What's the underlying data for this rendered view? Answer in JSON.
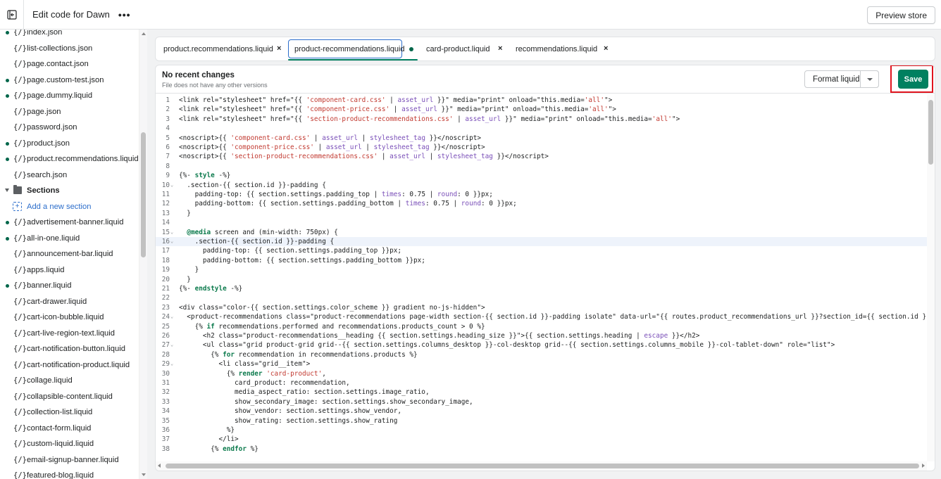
{
  "topbar": {
    "title": "Edit code for Dawn",
    "more_label": "•••",
    "preview_label": "Preview store"
  },
  "sidebar": {
    "files_top": [
      {
        "name": "index.json",
        "dot": true
      },
      {
        "name": "list-collections.json",
        "dot": false
      },
      {
        "name": "page.contact.json",
        "dot": false
      },
      {
        "name": "page.custom-test.json",
        "dot": true
      },
      {
        "name": "page.dummy.liquid",
        "dot": true
      },
      {
        "name": "page.json",
        "dot": false
      },
      {
        "name": "password.json",
        "dot": false
      },
      {
        "name": "product.json",
        "dot": true
      },
      {
        "name": "product.recommendations.liquid",
        "dot": true
      },
      {
        "name": "search.json",
        "dot": false
      }
    ],
    "folder_label": "Sections",
    "add_label": "Add a new section",
    "files_sections": [
      {
        "name": "advertisement-banner.liquid",
        "dot": true
      },
      {
        "name": "all-in-one.liquid",
        "dot": true
      },
      {
        "name": "announcement-bar.liquid",
        "dot": false
      },
      {
        "name": "apps.liquid",
        "dot": false
      },
      {
        "name": "banner.liquid",
        "dot": true
      },
      {
        "name": "cart-drawer.liquid",
        "dot": false
      },
      {
        "name": "cart-icon-bubble.liquid",
        "dot": false
      },
      {
        "name": "cart-live-region-text.liquid",
        "dot": false
      },
      {
        "name": "cart-notification-button.liquid",
        "dot": false
      },
      {
        "name": "cart-notification-product.liquid",
        "dot": false
      },
      {
        "name": "collage.liquid",
        "dot": false
      },
      {
        "name": "collapsible-content.liquid",
        "dot": false
      },
      {
        "name": "collection-list.liquid",
        "dot": false
      },
      {
        "name": "contact-form.liquid",
        "dot": false
      },
      {
        "name": "custom-liquid.liquid",
        "dot": false
      },
      {
        "name": "email-signup-banner.liquid",
        "dot": false
      },
      {
        "name": "featured-blog.liquid",
        "dot": false
      }
    ],
    "file_icon": "{/}"
  },
  "tabs": [
    {
      "label": "product.recommendations.liquid",
      "close": "×"
    },
    {
      "label": "product-recommendations.liquid",
      "close": ""
    },
    {
      "label": "card-product.liquid",
      "close": "×"
    },
    {
      "label": "recommendations.liquid",
      "close": "×"
    }
  ],
  "editor": {
    "header_title": "No recent changes",
    "header_sub": "File does not have any other versions",
    "format_label": "Format liquid",
    "save_label": "Save",
    "highlighted_line": 16,
    "lines": [
      {
        "n": "1",
        "t": "<link rel=\"stylesheet\" href=\"{{ 'component-card.css' | asset_url }}\" media=\"print\" onload=\"this.media='all'\">"
      },
      {
        "n": "2",
        "t": "<link rel=\"stylesheet\" href=\"{{ 'component-price.css' | asset_url }}\" media=\"print\" onload=\"this.media='all'\">"
      },
      {
        "n": "3",
        "t": "<link rel=\"stylesheet\" href=\"{{ 'section-product-recommendations.css' | asset_url }}\" media=\"print\" onload=\"this.media='all'\">"
      },
      {
        "n": "4",
        "t": ""
      },
      {
        "n": "5",
        "t": "<noscript>{{ 'component-card.css' | asset_url | stylesheet_tag }}</noscript>"
      },
      {
        "n": "6",
        "t": "<noscript>{{ 'component-price.css' | asset_url | stylesheet_tag }}</noscript>"
      },
      {
        "n": "7",
        "t": "<noscript>{{ 'section-product-recommendations.css' | asset_url | stylesheet_tag }}</noscript>"
      },
      {
        "n": "8",
        "t": ""
      },
      {
        "n": "9",
        "t": "{%- style -%}"
      },
      {
        "n": "10",
        "t": "  .section-{{ section.id }}-padding {",
        "fold": true
      },
      {
        "n": "11",
        "t": "    padding-top: {{ section.settings.padding_top | times: 0.75 | round: 0 }}px;"
      },
      {
        "n": "12",
        "t": "    padding-bottom: {{ section.settings.padding_bottom | times: 0.75 | round: 0 }}px;"
      },
      {
        "n": "13",
        "t": "  }"
      },
      {
        "n": "14",
        "t": ""
      },
      {
        "n": "15",
        "t": "  @media screen and (min-width: 750px) {",
        "fold": true
      },
      {
        "n": "16",
        "t": "    .section-{{ section.id }}-padding {",
        "fold": true
      },
      {
        "n": "17",
        "t": "      padding-top: {{ section.settings.padding_top }}px;"
      },
      {
        "n": "18",
        "t": "      padding-bottom: {{ section.settings.padding_bottom }}px;"
      },
      {
        "n": "19",
        "t": "    }"
      },
      {
        "n": "20",
        "t": "  }"
      },
      {
        "n": "21",
        "t": "{%- endstyle -%}"
      },
      {
        "n": "22",
        "t": ""
      },
      {
        "n": "23",
        "t": "<div class=\"color-{{ section.settings.color_scheme }} gradient no-js-hidden\">"
      },
      {
        "n": "24",
        "t": "  <product-recommendations class=\"product-recommendations page-width section-{{ section.id }}-padding isolate\" data-url=\"{{ routes.product_recommendations_url }}?section_id={{ section.id }}&product_",
        "fold": true
      },
      {
        "n": "25",
        "t": "    {% if recommendations.performed and recommendations.products_count > 0 %}"
      },
      {
        "n": "26",
        "t": "      <h2 class=\"product-recommendations__heading {{ section.settings.heading_size }}\">{{ section.settings.heading | escape }}</h2>"
      },
      {
        "n": "27",
        "t": "      <ul class=\"grid product-grid grid--{{ section.settings.columns_desktop }}-col-desktop grid--{{ section.settings.columns_mobile }}-col-tablet-down\" role=\"list\">",
        "fold": true
      },
      {
        "n": "28",
        "t": "        {% for recommendation in recommendations.products %}"
      },
      {
        "n": "29",
        "t": "          <li class=\"grid__item\">",
        "fold": true
      },
      {
        "n": "30",
        "t": "            {% render 'card-product',"
      },
      {
        "n": "31",
        "t": "              card_product: recommendation,"
      },
      {
        "n": "32",
        "t": "              media_aspect_ratio: section.settings.image_ratio,"
      },
      {
        "n": "33",
        "t": "              show_secondary_image: section.settings.show_secondary_image,"
      },
      {
        "n": "34",
        "t": "              show_vendor: section.settings.show_vendor,"
      },
      {
        "n": "35",
        "t": "              show_rating: section.settings.show_rating"
      },
      {
        "n": "36",
        "t": "            %}"
      },
      {
        "n": "37",
        "t": "          </li>"
      },
      {
        "n": "38",
        "t": "        {% endfor %}"
      }
    ]
  },
  "colors": {
    "accent": "#008060",
    "dot": "#00664a",
    "highlight_box": "#e0141e",
    "link": "#2c6ecb"
  }
}
